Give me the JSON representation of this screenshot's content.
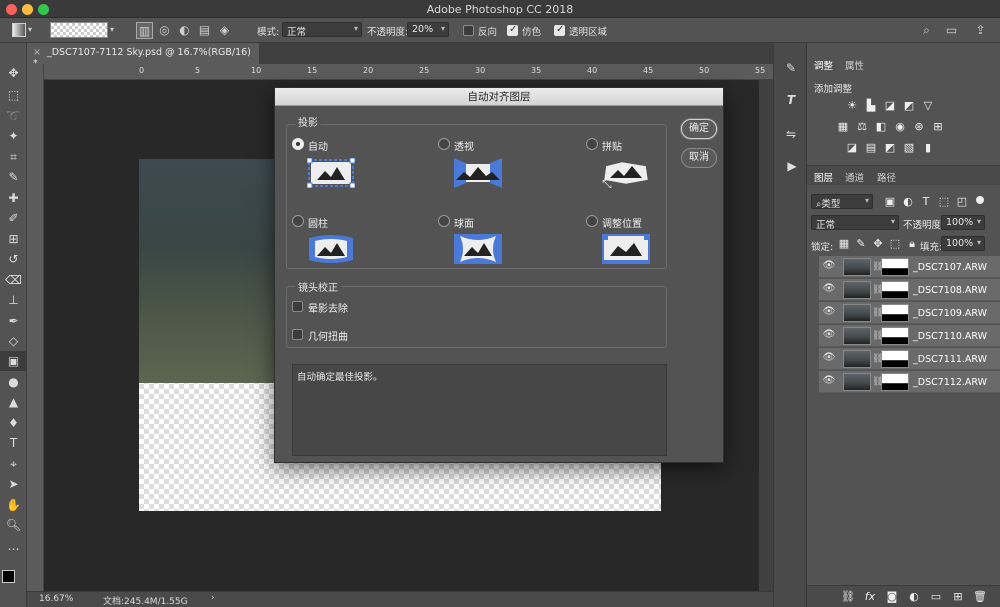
{
  "app": {
    "title": "Adobe Photoshop CC 2018"
  },
  "options": {
    "mode_label": "模式:",
    "mode_value": "正常",
    "opacity_label": "不透明度:",
    "opacity_value": "20%",
    "reverse_label": "反向",
    "reverse_checked": false,
    "dither_label": "仿色",
    "dither_checked": true,
    "transparency_label": "透明区域",
    "transparency_checked": true
  },
  "document": {
    "tab_label": "_DSC7107-7112 Sky.psd @ 16.7%(RGB/16) *",
    "ruler_ticks": [
      "0",
      "5",
      "10",
      "15",
      "20",
      "25",
      "30",
      "35",
      "40",
      "45",
      "50",
      "55",
      "60"
    ]
  },
  "status": {
    "zoom": "16.67%",
    "doc_info": "文档:245.4M/1.55G"
  },
  "dialog": {
    "title": "自动对齐图层",
    "projection_label": "投影",
    "options": [
      {
        "label": "自动",
        "selected": true
      },
      {
        "label": "透视",
        "selected": false
      },
      {
        "label": "拼贴",
        "selected": false
      },
      {
        "label": "圆柱",
        "selected": false
      },
      {
        "label": "球面",
        "selected": false
      },
      {
        "label": "调整位置",
        "selected": false
      }
    ],
    "lens_label": "镜头校正",
    "vignette_label": "晕影去除",
    "vignette_checked": false,
    "distortion_label": "几何扭曲",
    "distortion_checked": false,
    "ok_label": "确定",
    "cancel_label": "取消",
    "description": "自动确定最佳投影。",
    "accent_color": "#4a79d8"
  },
  "panels": {
    "adjustments_tab": "调整",
    "properties_tab": "属性",
    "add_adjustment": "添加调整",
    "layers_tab": "图层",
    "channels_tab": "通道",
    "paths_tab": "路径",
    "filter_kind": "类型",
    "blend_mode": "正常",
    "opacity_label": "不透明度:",
    "opacity_value": "100%",
    "lock_label": "锁定:",
    "fill_label": "填充:",
    "fill_value": "100%"
  },
  "layers": [
    {
      "name": "_DSC7107.ARW"
    },
    {
      "name": "_DSC7108.ARW"
    },
    {
      "name": "_DSC7109.ARW"
    },
    {
      "name": "_DSC7110.ARW"
    },
    {
      "name": "_DSC7111.ARW"
    },
    {
      "name": "_DSC7112.ARW"
    }
  ]
}
